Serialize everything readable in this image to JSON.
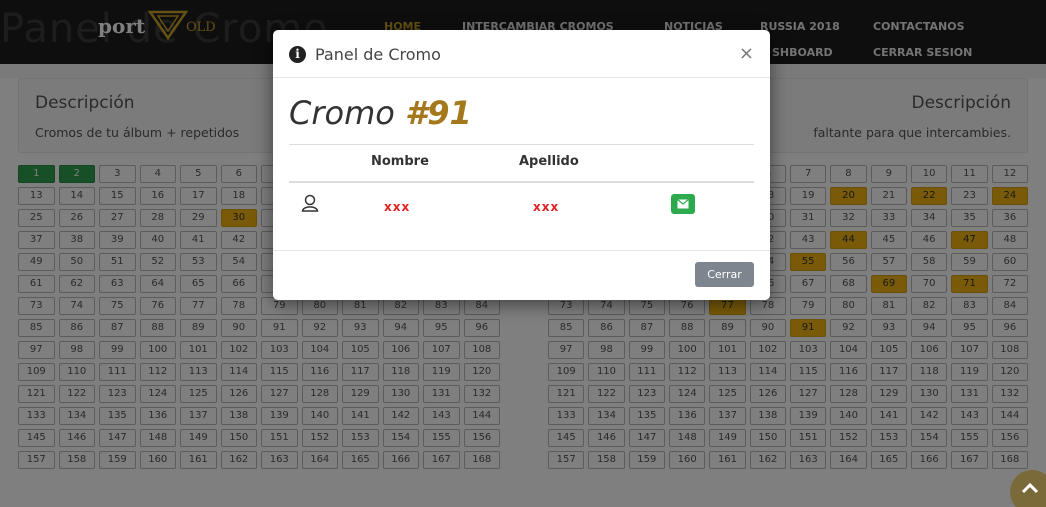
{
  "header": {
    "bg_title": "Panel de Cromo",
    "logo_text": "port",
    "logo_suffix": "OLD",
    "nav": [
      {
        "label": "HOME",
        "active": true
      },
      {
        "label": "INTERCAMBIAR CROMOS"
      },
      {
        "label": "NOTICIAS"
      },
      {
        "label": "RUSSIA 2018"
      },
      {
        "label": "CONTACTANOS"
      },
      {
        "label": "SHBOARD"
      },
      {
        "label": "CERRAR SESION"
      }
    ]
  },
  "left_panel": {
    "title": "Descripción",
    "text": "Cromos de tu álbum + repetidos"
  },
  "right_panel": {
    "title": "Descripción",
    "text": "faltante para que intercambies."
  },
  "left_grid": {
    "green": [
      1,
      2
    ],
    "yellow": [
      30
    ]
  },
  "right_grid": {
    "yellow": [
      20,
      22,
      24,
      44,
      47,
      55,
      69,
      71,
      77,
      91
    ]
  },
  "modal": {
    "title": "Panel de Cromo",
    "close": "×",
    "cromo_label": "Cromo",
    "cromo_number": "#91",
    "columns": {
      "nombre": "Nombre",
      "apellido": "Apellido"
    },
    "row": {
      "nombre": "xxx",
      "apellido": "xxx"
    },
    "close_button": "Cerrar"
  },
  "colors": {
    "green": "#2e9e4f",
    "yellow": "#f0b513",
    "gold": "#a4791d",
    "dark": "#1c1c1c"
  }
}
